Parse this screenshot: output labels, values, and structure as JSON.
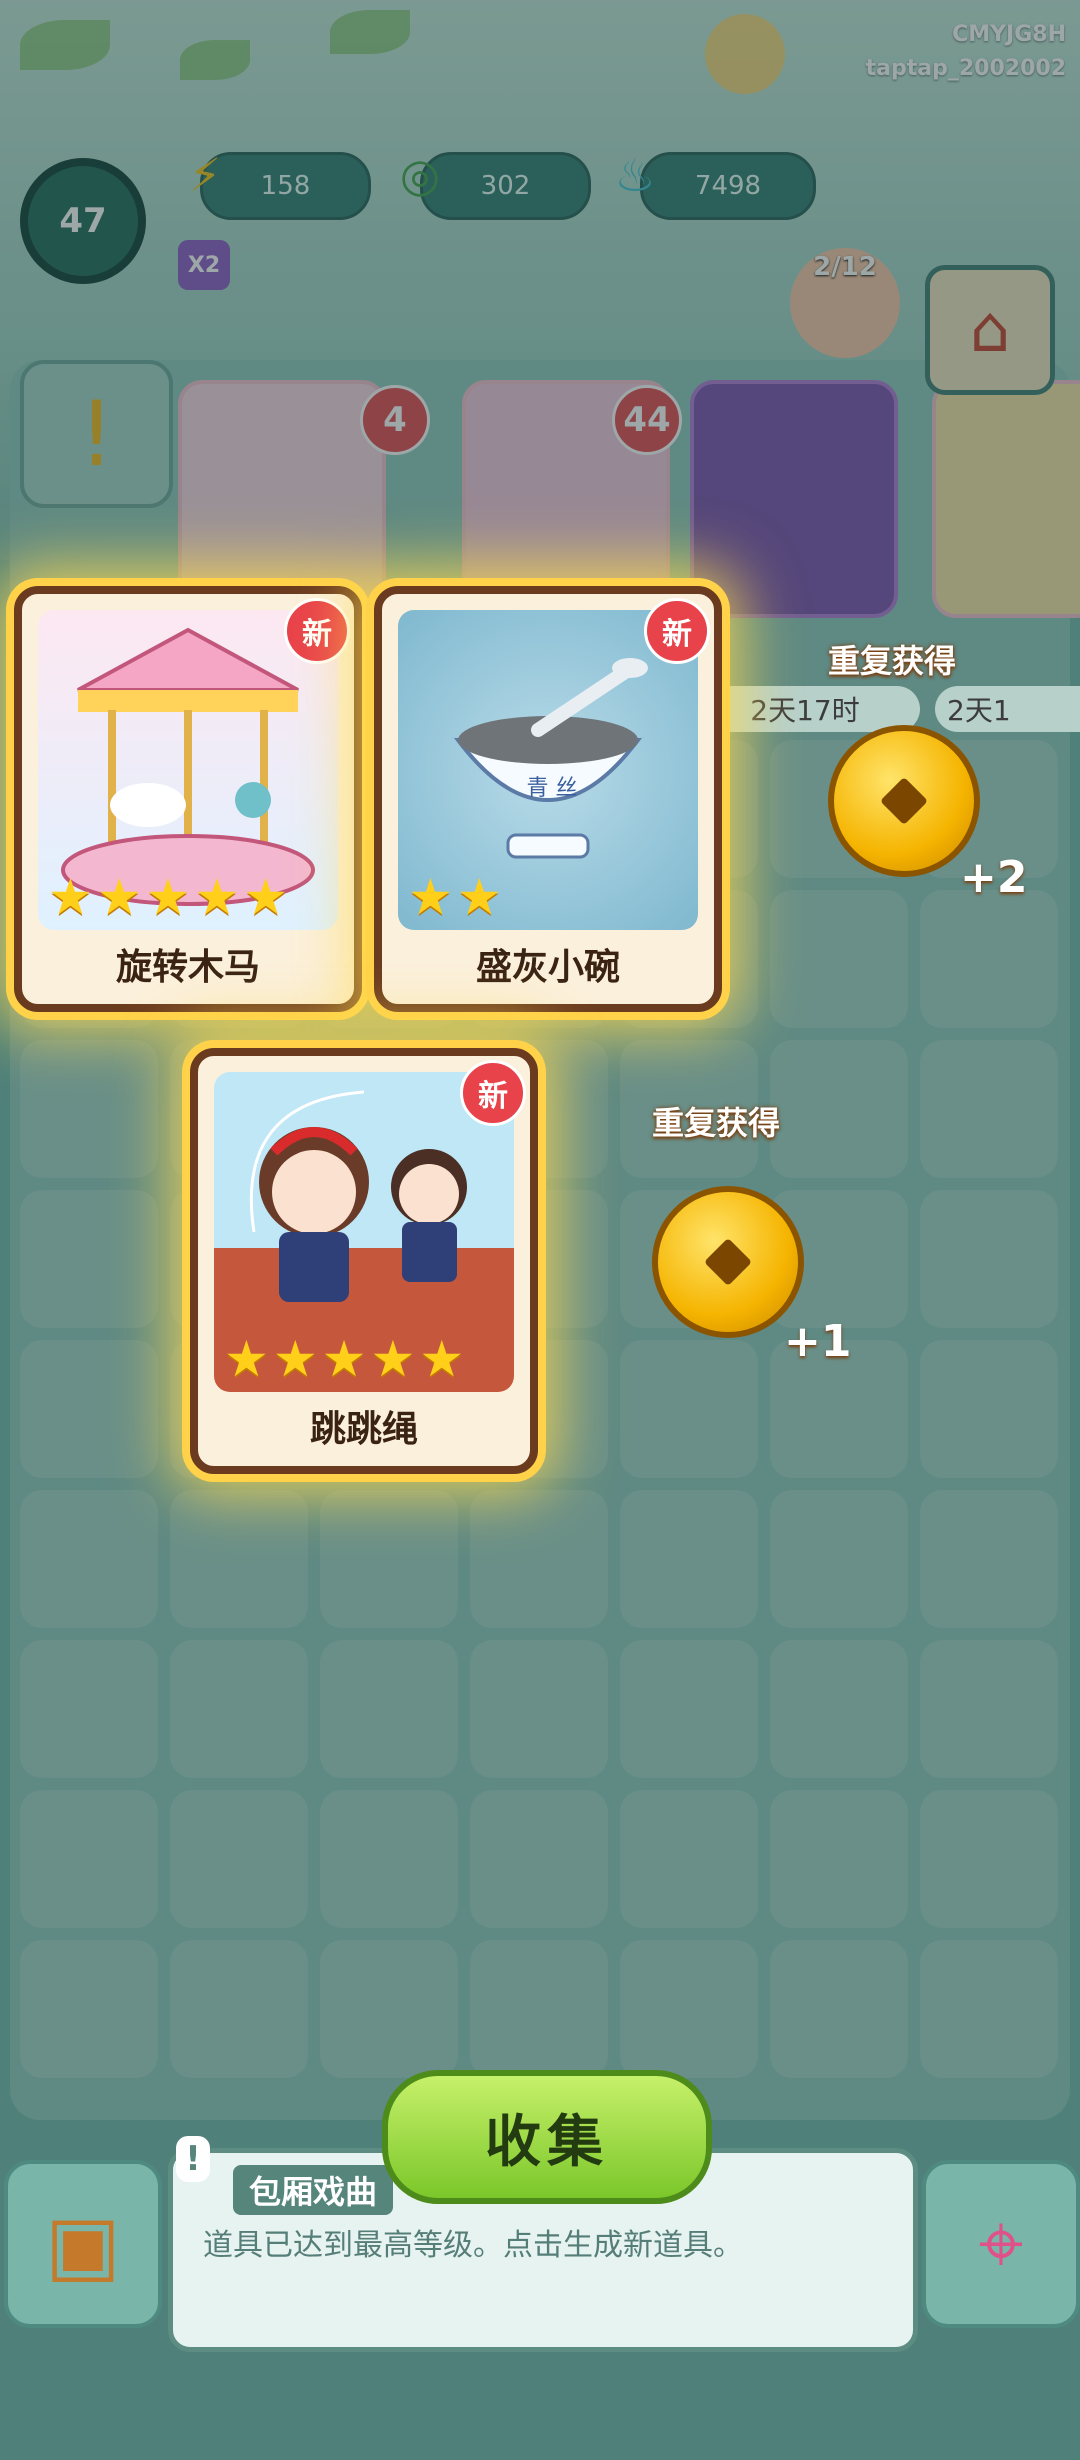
{
  "player": {
    "ids": [
      "CMYJG8H",
      "taptap_2002002"
    ],
    "level": "47",
    "multiplier": "X2"
  },
  "resources": [
    {
      "icon": "energy-icon",
      "value": "158"
    },
    {
      "icon": "jade-coin-icon",
      "value": "302"
    },
    {
      "icon": "blue-flame-icon",
      "value": "7498"
    }
  ],
  "top_row": {
    "npc_progress": "2/12",
    "badges": [
      "4",
      "44"
    ],
    "timers": [
      "2天17时",
      "2天1"
    ]
  },
  "new_cards": [
    {
      "label": "旋转木马",
      "stars": 5,
      "badge": "新"
    },
    {
      "label": "盛灰小碗",
      "stars": 2,
      "badge": "新",
      "bowl_text": "青 丝"
    },
    {
      "label": "跳跳绳",
      "stars": 5,
      "badge": "新"
    }
  ],
  "duplicates": [
    {
      "label": "重复获得",
      "reward": "+2"
    },
    {
      "label": "重复获得",
      "reward": "+1"
    }
  ],
  "collect_button": "收集",
  "info": {
    "title": "包厢戏曲",
    "message": "道具已达到最高等级。点击生成新道具。"
  },
  "colors": {
    "accent": "#ffd24a",
    "collect_green": "#7bc72a",
    "badge_red": "#e8424a"
  }
}
